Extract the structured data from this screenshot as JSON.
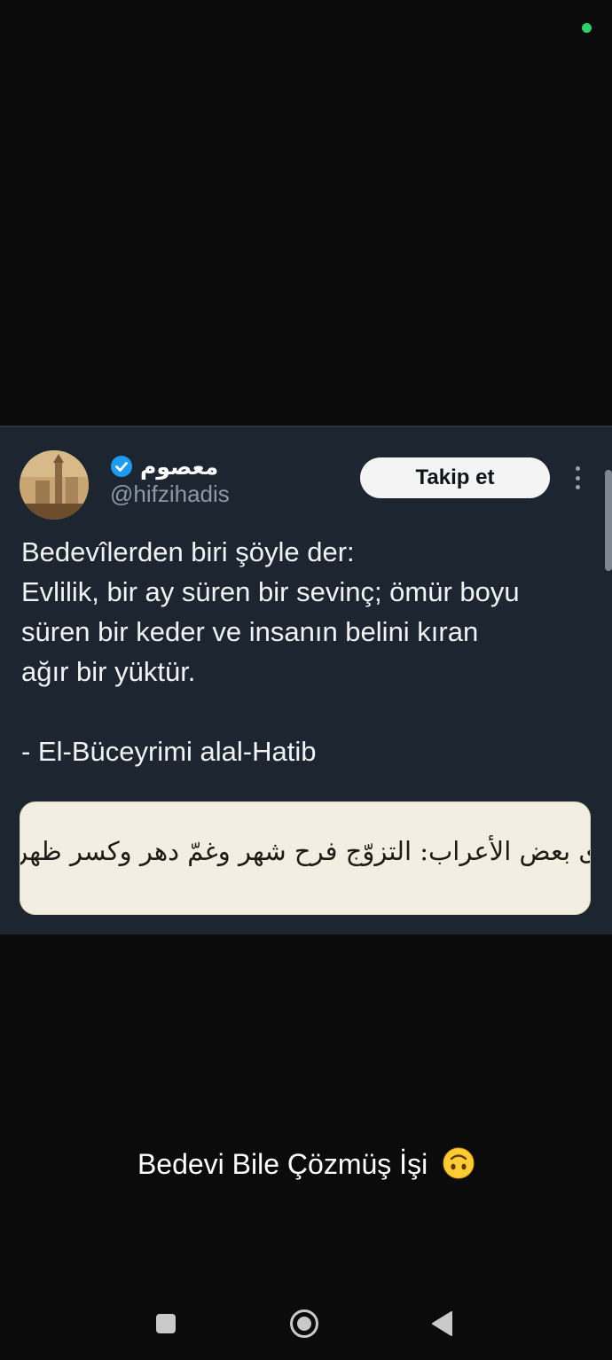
{
  "tweet": {
    "display_name": "معصوم",
    "handle": "@hifzihadis",
    "follow_label": "Takip et",
    "lines": [
      "Bedevîlerden biri şöyle der:",
      "Evlilik, bir ay süren bir sevinç; ömür boyu",
      "süren bir keder ve insanın belini kıran",
      "ağır bir yüktür."
    ],
    "attribution": "- El-Büceyrimi alal-Hatib",
    "image_text": "ى بعض الأعراب: التزوّج فرح شهر وغمّ دهر وكسر ظهر"
  },
  "caption": "Bedevi Bile Çözmüş İşi",
  "icons": {
    "status": "status-dot",
    "verified": "verified-badge-icon",
    "more": "more-vertical-icon",
    "emoji": "upside-down-face-icon",
    "nav": [
      "recents-square-icon",
      "home-circle-icon",
      "back-triangle-icon"
    ]
  },
  "colors": {
    "card_bg": "#1d2630",
    "verified": "#1d9bf0",
    "status_dot": "#2fd06a"
  }
}
